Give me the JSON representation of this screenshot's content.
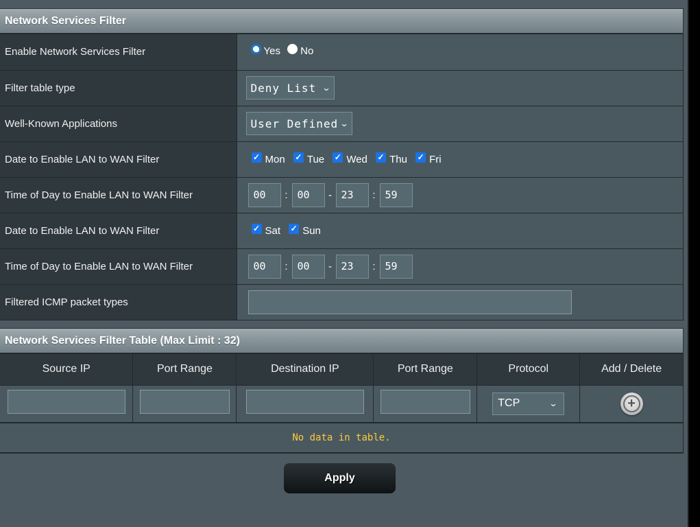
{
  "filter_section": {
    "title": "Network Services Filter",
    "rows": [
      {
        "label": "Enable Network Services Filter"
      },
      {
        "label": "Filter table type"
      },
      {
        "label": "Well-Known Applications"
      },
      {
        "label": "Date to Enable LAN to WAN Filter"
      },
      {
        "label": "Time of Day to Enable LAN to WAN Filter"
      },
      {
        "label": "Date to Enable LAN to WAN Filter"
      },
      {
        "label": "Time of Day to Enable LAN to WAN Filter"
      },
      {
        "label": "Filtered ICMP packet types"
      }
    ],
    "enable": {
      "yes_label": "Yes",
      "no_label": "No",
      "selected": "Yes"
    },
    "filter_table_type": {
      "value": "Deny List"
    },
    "well_known_apps": {
      "value": "User Defined"
    },
    "weekdays": [
      {
        "label": "Mon",
        "checked": true
      },
      {
        "label": "Tue",
        "checked": true
      },
      {
        "label": "Wed",
        "checked": true
      },
      {
        "label": "Thu",
        "checked": true
      },
      {
        "label": "Fri",
        "checked": true
      }
    ],
    "weekday_time": {
      "start_hour": "00",
      "start_min": "00",
      "end_hour": "23",
      "end_min": "59"
    },
    "weekend": [
      {
        "label": "Sat",
        "checked": true
      },
      {
        "label": "Sun",
        "checked": true
      }
    ],
    "weekend_time": {
      "start_hour": "00",
      "start_min": "00",
      "end_hour": "23",
      "end_min": "59"
    },
    "icmp_value": "",
    "colon": ":",
    "dash": "-"
  },
  "table_section": {
    "title": "Network Services Filter Table (Max Limit : 32)",
    "columns": [
      "Source IP",
      "Port Range",
      "Destination IP",
      "Port Range",
      "Protocol",
      "Add / Delete"
    ],
    "protocol_value": "TCP",
    "empty_message": "No data in table."
  },
  "apply_label": "Apply",
  "icons": {
    "chevron": "⌄",
    "check": "✓",
    "plus": "+"
  }
}
